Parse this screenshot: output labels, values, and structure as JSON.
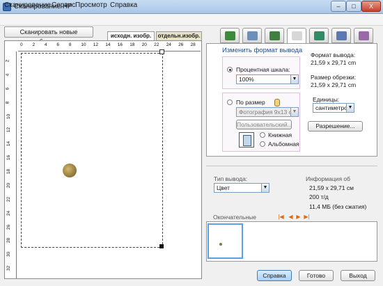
{
  "window": {
    "title": "Сканирование HP",
    "min_label": "–",
    "max_label": "□",
    "close_label": "X"
  },
  "menu": [
    "Сканирование",
    "Сервис",
    "Просмотр",
    "Справка"
  ],
  "left": {
    "scan_new_label": "Сканировать новые изображения",
    "tab_original": "исходн. изобр.",
    "tab_separate": "отдельн.изобр.",
    "ruler_top": [
      "0",
      "2",
      "4",
      "6",
      "8",
      "10",
      "12",
      "14",
      "16",
      "18",
      "20",
      "22",
      "24",
      "26",
      "28"
    ],
    "ruler_left": [
      "2",
      "4",
      "6",
      "8",
      "10",
      "12",
      "14",
      "16",
      "18",
      "20",
      "22",
      "24",
      "26",
      "28",
      "30",
      "32"
    ]
  },
  "toolbar": {
    "tabs": [
      {
        "name": "tab-output-type",
        "icon": "output-type-icon",
        "color": "#3a8c3a"
      },
      {
        "name": "tab-color",
        "icon": "color-adjust-icon",
        "color": "#6a8fb8"
      },
      {
        "name": "tab-crop",
        "icon": "crop-icon",
        "color": "#3f7f3f"
      },
      {
        "name": "tab-resize",
        "icon": "resize-icon",
        "color": "#d7d7d7"
      },
      {
        "name": "tab-export",
        "icon": "export-icon",
        "color": "#2e8d64"
      },
      {
        "name": "tab-sharpen",
        "icon": "sharpen-icon",
        "color": "#5a78b4"
      },
      {
        "name": "tab-settings",
        "icon": "settings-icon",
        "color": "#9a6aa8"
      }
    ],
    "active_index": 3
  },
  "output": {
    "title": "Изменить формат вывода",
    "percent_label": "Процентная шкала:",
    "percent_value": "100%",
    "fit_label": "По размер",
    "fit_value": "Фотография 9x13 см",
    "custom_label": "Пользовательский...",
    "portrait_label": "Книжная",
    "landscape_label": "Альбомная",
    "output_format_label": "Формат вывода:",
    "output_format_value": "21,59 x 29,71 cm",
    "crop_size_label": "Размер обрезки:",
    "crop_size_value": "21,59 x 29,71 cm",
    "units_label": "Единицы:",
    "units_value": "сантиметро",
    "resolution_label": "Разрешение..."
  },
  "output_type": {
    "label": "Тип вывода:",
    "value": "Цвет"
  },
  "info": {
    "label": "Информация об",
    "size": "21,59 x 29,71 см",
    "dpi": "200 т/д",
    "filesize": "11,4 МБ (без сжатия)"
  },
  "final": {
    "label": "Окончательные"
  },
  "buttons": {
    "help": "Справка",
    "done": "Готово",
    "exit": "Выход"
  }
}
